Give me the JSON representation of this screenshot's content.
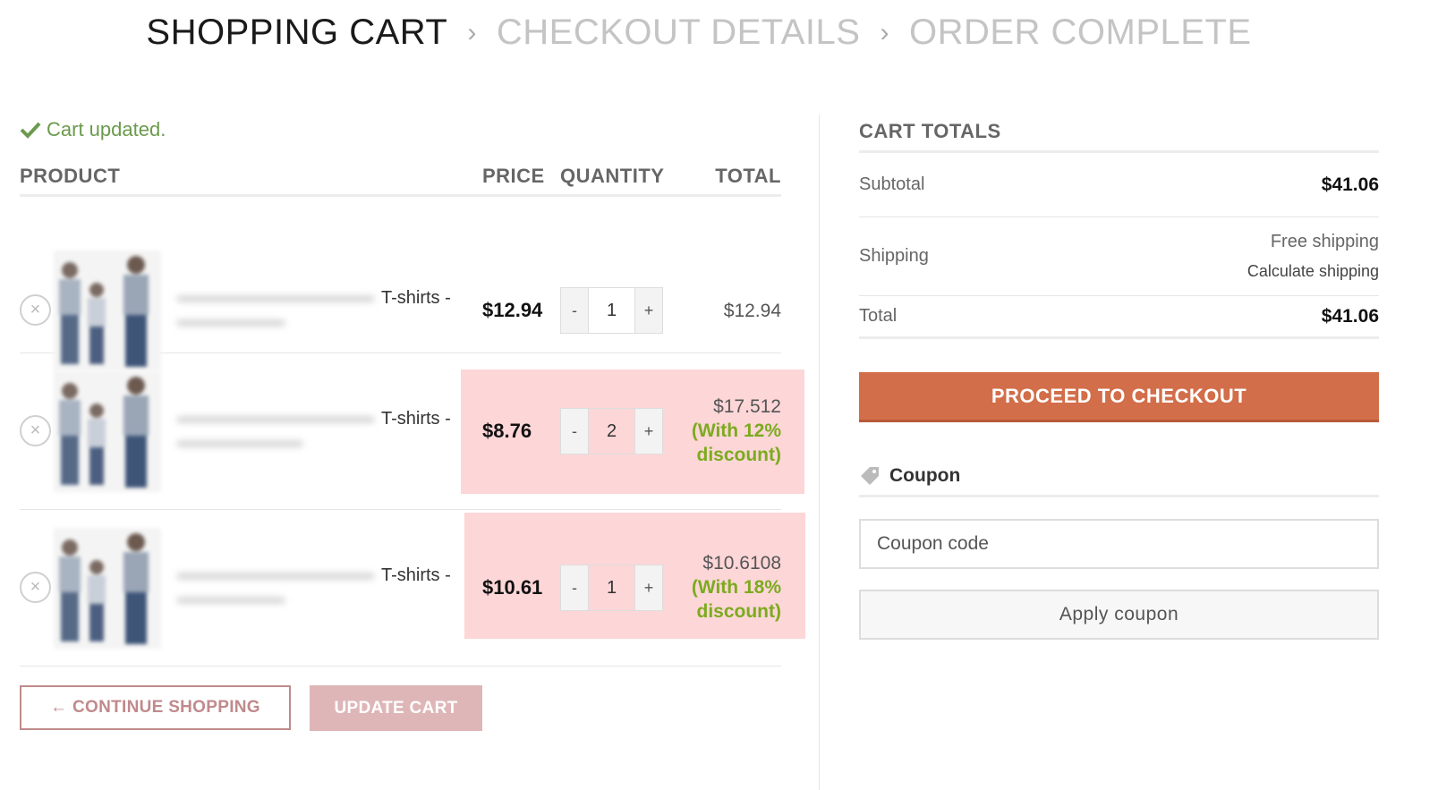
{
  "breadcrumb": {
    "steps": [
      "SHOPPING CART",
      "CHECKOUT DETAILS",
      "ORDER COMPLETE"
    ],
    "separator": "›"
  },
  "notice": {
    "text": "Cart updated."
  },
  "table": {
    "headers": {
      "product": "PRODUCT",
      "price": "PRICE",
      "quantity": "QUANTITY",
      "total": "TOTAL"
    },
    "rows": [
      {
        "name": "T-shirts -",
        "price": "$12.94",
        "qty": "1",
        "total": "$12.94",
        "discount": "",
        "highlight": false
      },
      {
        "name": "T-shirts -",
        "price": "$8.76",
        "qty": "2",
        "total": "$17.512",
        "discount": "(With 12% discount)",
        "highlight": true
      },
      {
        "name": "T-shirts -",
        "price": "$10.61",
        "qty": "1",
        "total": "$10.6108",
        "discount": "(With 18% discount)",
        "highlight": true
      }
    ],
    "qty_minus": "-",
    "qty_plus": "+",
    "remove_glyph": "×"
  },
  "actions": {
    "continue_label": "← CONTINUE SHOPPING",
    "update_label": "UPDATE CART"
  },
  "totals": {
    "title": "CART TOTALS",
    "subtotal_label": "Subtotal",
    "subtotal_value": "$41.06",
    "shipping_label": "Shipping",
    "shipping_value": "Free shipping",
    "shipping_link": "Calculate shipping",
    "total_label": "Total",
    "total_value": "$41.06",
    "checkout_label": "PROCEED TO CHECKOUT"
  },
  "coupon": {
    "title": "Coupon",
    "placeholder": "Coupon code",
    "apply_label": "Apply coupon"
  },
  "colors": {
    "accent": "#d26e49",
    "highlight_row": "#fdd6d8",
    "discount": "#7bab1e",
    "notice": "#6b9a4d"
  }
}
